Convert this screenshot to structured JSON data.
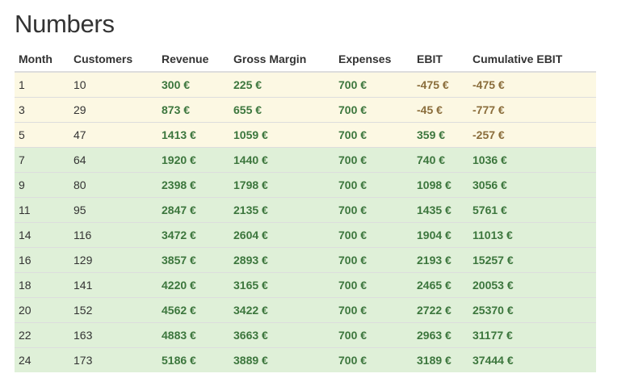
{
  "page": {
    "title": "Numbers"
  },
  "table": {
    "headers": [
      "Month",
      "Customers",
      "Revenue",
      "Gross Margin",
      "Expenses",
      "EBIT",
      "Cumulative EBIT"
    ],
    "rows": [
      {
        "status": "warn",
        "cells": [
          "1",
          "10",
          "300 €",
          "225 €",
          "700 €",
          "-475 €",
          "-475 €"
        ]
      },
      {
        "status": "warn",
        "cells": [
          "3",
          "29",
          "873 €",
          "655 €",
          "700 €",
          "-45 €",
          "-777 €"
        ]
      },
      {
        "status": "warn",
        "cells": [
          "5",
          "47",
          "1413 €",
          "1059 €",
          "700 €",
          "359 €",
          "-257 €"
        ]
      },
      {
        "status": "ok",
        "cells": [
          "7",
          "64",
          "1920 €",
          "1440 €",
          "700 €",
          "740 €",
          "1036 €"
        ]
      },
      {
        "status": "ok",
        "cells": [
          "9",
          "80",
          "2398 €",
          "1798 €",
          "700 €",
          "1098 €",
          "3056 €"
        ]
      },
      {
        "status": "ok",
        "cells": [
          "11",
          "95",
          "2847 €",
          "2135 €",
          "700 €",
          "1435 €",
          "5761 €"
        ]
      },
      {
        "status": "ok",
        "cells": [
          "14",
          "116",
          "3472 €",
          "2604 €",
          "700 €",
          "1904 €",
          "11013 €"
        ]
      },
      {
        "status": "ok",
        "cells": [
          "16",
          "129",
          "3857 €",
          "2893 €",
          "700 €",
          "2193 €",
          "15257 €"
        ]
      },
      {
        "status": "ok",
        "cells": [
          "18",
          "141",
          "4220 €",
          "3165 €",
          "700 €",
          "2465 €",
          "20053 €"
        ]
      },
      {
        "status": "ok",
        "cells": [
          "20",
          "152",
          "4562 €",
          "3422 €",
          "700 €",
          "2722 €",
          "25370 €"
        ]
      },
      {
        "status": "ok",
        "cells": [
          "22",
          "163",
          "4883 €",
          "3663 €",
          "700 €",
          "2963 €",
          "31177 €"
        ]
      },
      {
        "status": "ok",
        "cells": [
          "24",
          "173",
          "5186 €",
          "3889 €",
          "700 €",
          "3189 €",
          "37444 €"
        ]
      }
    ]
  },
  "colors": {
    "warn_row_bg": "#fcf8e3",
    "ok_row_bg": "#dff0d8",
    "positive_text": "#3c763d",
    "negative_text": "#8a6d3b"
  }
}
